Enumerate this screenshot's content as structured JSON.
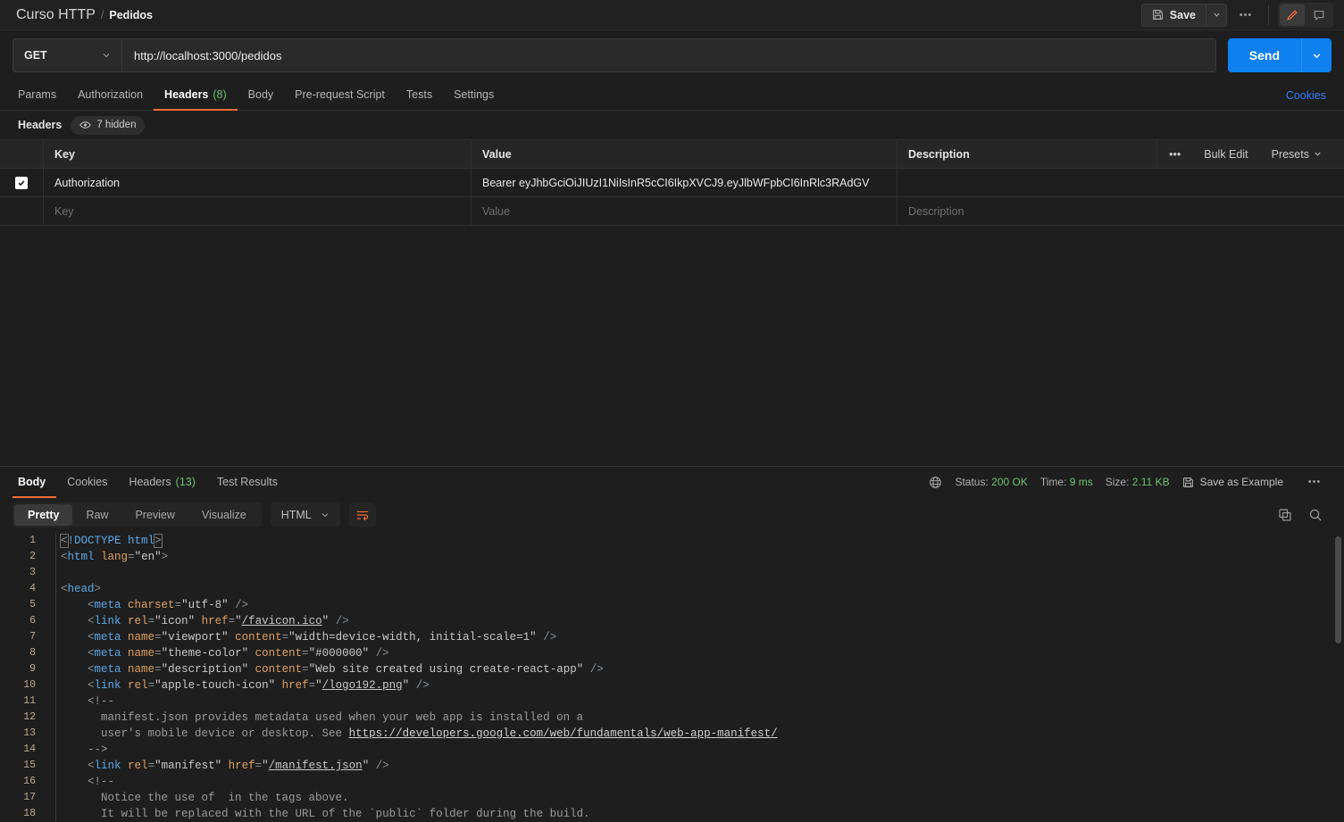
{
  "breadcrumb": {
    "collection": "Curso HTTP",
    "separator": "/",
    "current": "Pedidos"
  },
  "topbar": {
    "save_label": "Save",
    "save_caret_icon": "chevron-down-icon",
    "more_icon": "ellipsis-icon",
    "edit_icon": "pencil-icon",
    "comment_icon": "comment-icon",
    "accent": "#ff6c37"
  },
  "request": {
    "method": "GET",
    "url": "http://localhost:3000/pedidos",
    "send_label": "Send",
    "send_caret_icon": "chevron-down-icon",
    "send_color": "#0f80f0"
  },
  "request_tabs": [
    {
      "label": "Params",
      "count": "",
      "active": false
    },
    {
      "label": "Authorization",
      "count": "",
      "active": false
    },
    {
      "label": "Headers",
      "count": "(8)",
      "active": true
    },
    {
      "label": "Body",
      "count": "",
      "active": false
    },
    {
      "label": "Pre-request Script",
      "count": "",
      "active": false
    },
    {
      "label": "Tests",
      "count": "",
      "active": false
    },
    {
      "label": "Settings",
      "count": "",
      "active": false
    }
  ],
  "cookies_link": "Cookies",
  "headers_section": {
    "label": "Headers",
    "hidden_pill": "7 hidden",
    "hidden_pill_icon": "eye-icon",
    "columns": {
      "key": "Key",
      "value": "Value",
      "description": "Description"
    },
    "actions": {
      "more_icon": "ellipsis-icon",
      "bulk_edit": "Bulk Edit",
      "presets": "Presets",
      "presets_icon": "chevron-down-icon"
    },
    "rows": [
      {
        "checked": true,
        "key": "Authorization",
        "value": "Bearer eyJhbGciOiJIUzI1NiIsInR5cCI6IkpXVCJ9.eyJlbWFpbCI6InRlc3RAdGV",
        "description": ""
      }
    ],
    "placeholder_row": {
      "key": "Key",
      "value": "Value",
      "description": "Description"
    }
  },
  "response": {
    "tabs": [
      {
        "label": "Body",
        "count": "",
        "active": true
      },
      {
        "label": "Cookies",
        "count": "",
        "active": false
      },
      {
        "label": "Headers",
        "count": "(13)",
        "active": false
      },
      {
        "label": "Test Results",
        "count": "",
        "active": false
      }
    ],
    "globe_icon": "globe-icon",
    "status_label": "Status:",
    "status_value": "200 OK",
    "time_label": "Time:",
    "time_value": "9 ms",
    "size_label": "Size:",
    "size_value": "2.11 KB",
    "save_example": "Save as Example",
    "save_example_icon": "floppy-icon",
    "more_icon": "ellipsis-icon",
    "status_color": "#6bc072",
    "view_modes": [
      {
        "label": "Pretty",
        "active": true
      },
      {
        "label": "Raw",
        "active": false
      },
      {
        "label": "Preview",
        "active": false
      },
      {
        "label": "Visualize",
        "active": false
      }
    ],
    "language": "HTML",
    "language_caret_icon": "chevron-down-icon",
    "wrap_icon": "wrap-text-icon",
    "copy_icon": "copy-icon",
    "search_icon": "search-icon"
  },
  "code_lines": [
    {
      "n": "1",
      "tokens": [
        {
          "t": "br-m",
          "v": "<"
        },
        {
          "t": "tag",
          "v": "!DOCTYPE "
        },
        {
          "t": "attr2",
          "v": "html"
        },
        {
          "t": "br-m",
          "v": ">"
        }
      ]
    },
    {
      "n": "2",
      "tokens": [
        {
          "t": "br",
          "v": "<"
        },
        {
          "t": "tag",
          "v": "html "
        },
        {
          "t": "attr",
          "v": "lang"
        },
        {
          "t": "br",
          "v": "="
        },
        {
          "t": "str",
          "v": "\"en\""
        },
        {
          "t": "br",
          "v": ">"
        }
      ]
    },
    {
      "n": "3",
      "tokens": []
    },
    {
      "n": "4",
      "tokens": [
        {
          "t": "br",
          "v": "<"
        },
        {
          "t": "tag",
          "v": "head"
        },
        {
          "t": "br",
          "v": ">"
        }
      ]
    },
    {
      "n": "5",
      "tokens": [
        {
          "t": "txt",
          "v": "    "
        },
        {
          "t": "br",
          "v": "<"
        },
        {
          "t": "tag",
          "v": "meta "
        },
        {
          "t": "attr",
          "v": "charset"
        },
        {
          "t": "br",
          "v": "="
        },
        {
          "t": "str",
          "v": "\"utf-8\""
        },
        {
          "t": "br",
          "v": " />"
        }
      ]
    },
    {
      "n": "6",
      "tokens": [
        {
          "t": "txt",
          "v": "    "
        },
        {
          "t": "br",
          "v": "<"
        },
        {
          "t": "tag",
          "v": "link "
        },
        {
          "t": "attr",
          "v": "rel"
        },
        {
          "t": "br",
          "v": "="
        },
        {
          "t": "str",
          "v": "\"icon\""
        },
        {
          "t": "txt",
          "v": " "
        },
        {
          "t": "attr",
          "v": "href"
        },
        {
          "t": "br",
          "v": "="
        },
        {
          "t": "str",
          "v": "\""
        },
        {
          "t": "strlink",
          "v": "/favicon.ico"
        },
        {
          "t": "str",
          "v": "\""
        },
        {
          "t": "br",
          "v": " />"
        }
      ]
    },
    {
      "n": "7",
      "tokens": [
        {
          "t": "txt",
          "v": "    "
        },
        {
          "t": "br",
          "v": "<"
        },
        {
          "t": "tag",
          "v": "meta "
        },
        {
          "t": "attr",
          "v": "name"
        },
        {
          "t": "br",
          "v": "="
        },
        {
          "t": "str",
          "v": "\"viewport\""
        },
        {
          "t": "txt",
          "v": " "
        },
        {
          "t": "attr",
          "v": "content"
        },
        {
          "t": "br",
          "v": "="
        },
        {
          "t": "str",
          "v": "\"width=device-width, initial-scale=1\""
        },
        {
          "t": "br",
          "v": " />"
        }
      ]
    },
    {
      "n": "8",
      "tokens": [
        {
          "t": "txt",
          "v": "    "
        },
        {
          "t": "br",
          "v": "<"
        },
        {
          "t": "tag",
          "v": "meta "
        },
        {
          "t": "attr",
          "v": "name"
        },
        {
          "t": "br",
          "v": "="
        },
        {
          "t": "str",
          "v": "\"theme-color\""
        },
        {
          "t": "txt",
          "v": " "
        },
        {
          "t": "attr",
          "v": "content"
        },
        {
          "t": "br",
          "v": "="
        },
        {
          "t": "str",
          "v": "\"#000000\""
        },
        {
          "t": "br",
          "v": " />"
        }
      ]
    },
    {
      "n": "9",
      "tokens": [
        {
          "t": "txt",
          "v": "    "
        },
        {
          "t": "br",
          "v": "<"
        },
        {
          "t": "tag",
          "v": "meta "
        },
        {
          "t": "attr",
          "v": "name"
        },
        {
          "t": "br",
          "v": "="
        },
        {
          "t": "str",
          "v": "\"description\""
        },
        {
          "t": "txt",
          "v": " "
        },
        {
          "t": "attr",
          "v": "content"
        },
        {
          "t": "br",
          "v": "="
        },
        {
          "t": "str",
          "v": "\"Web site created using create-react-app\""
        },
        {
          "t": "br",
          "v": " />"
        }
      ]
    },
    {
      "n": "10",
      "tokens": [
        {
          "t": "txt",
          "v": "    "
        },
        {
          "t": "br",
          "v": "<"
        },
        {
          "t": "tag",
          "v": "link "
        },
        {
          "t": "attr",
          "v": "rel"
        },
        {
          "t": "br",
          "v": "="
        },
        {
          "t": "str",
          "v": "\"apple-touch-icon\""
        },
        {
          "t": "txt",
          "v": " "
        },
        {
          "t": "attr",
          "v": "href"
        },
        {
          "t": "br",
          "v": "="
        },
        {
          "t": "str",
          "v": "\""
        },
        {
          "t": "strlink",
          "v": "/logo192.png"
        },
        {
          "t": "str",
          "v": "\""
        },
        {
          "t": "br",
          "v": " />"
        }
      ]
    },
    {
      "n": "11",
      "tokens": [
        {
          "t": "txt",
          "v": "    "
        },
        {
          "t": "cmt",
          "v": "<!--"
        }
      ]
    },
    {
      "n": "12",
      "tokens": [
        {
          "t": "txt",
          "v": "      "
        },
        {
          "t": "cmt",
          "v": "manifest.json provides metadata used when your web app is installed on a"
        }
      ]
    },
    {
      "n": "13",
      "tokens": [
        {
          "t": "txt",
          "v": "      "
        },
        {
          "t": "cmt",
          "v": "user's mobile device or desktop. See "
        },
        {
          "t": "cmtlink",
          "v": "https://developers.google.com/web/fundamentals/web-app-manifest/"
        }
      ]
    },
    {
      "n": "14",
      "tokens": [
        {
          "t": "txt",
          "v": "    "
        },
        {
          "t": "cmt",
          "v": "-->"
        }
      ]
    },
    {
      "n": "15",
      "tokens": [
        {
          "t": "txt",
          "v": "    "
        },
        {
          "t": "br",
          "v": "<"
        },
        {
          "t": "tag",
          "v": "link "
        },
        {
          "t": "attr",
          "v": "rel"
        },
        {
          "t": "br",
          "v": "="
        },
        {
          "t": "str",
          "v": "\"manifest\""
        },
        {
          "t": "txt",
          "v": " "
        },
        {
          "t": "attr",
          "v": "href"
        },
        {
          "t": "br",
          "v": "="
        },
        {
          "t": "str",
          "v": "\""
        },
        {
          "t": "strlink",
          "v": "/manifest.json"
        },
        {
          "t": "str",
          "v": "\""
        },
        {
          "t": "br",
          "v": " />"
        }
      ]
    },
    {
      "n": "16",
      "tokens": [
        {
          "t": "txt",
          "v": "    "
        },
        {
          "t": "cmt",
          "v": "<!--"
        }
      ]
    },
    {
      "n": "17",
      "tokens": [
        {
          "t": "txt",
          "v": "      "
        },
        {
          "t": "cmt",
          "v": "Notice the use of  in the tags above."
        }
      ]
    },
    {
      "n": "18",
      "tokens": [
        {
          "t": "txt",
          "v": "      "
        },
        {
          "t": "cmt",
          "v": "It will be replaced with the URL of the `public` folder during the build."
        }
      ]
    }
  ]
}
